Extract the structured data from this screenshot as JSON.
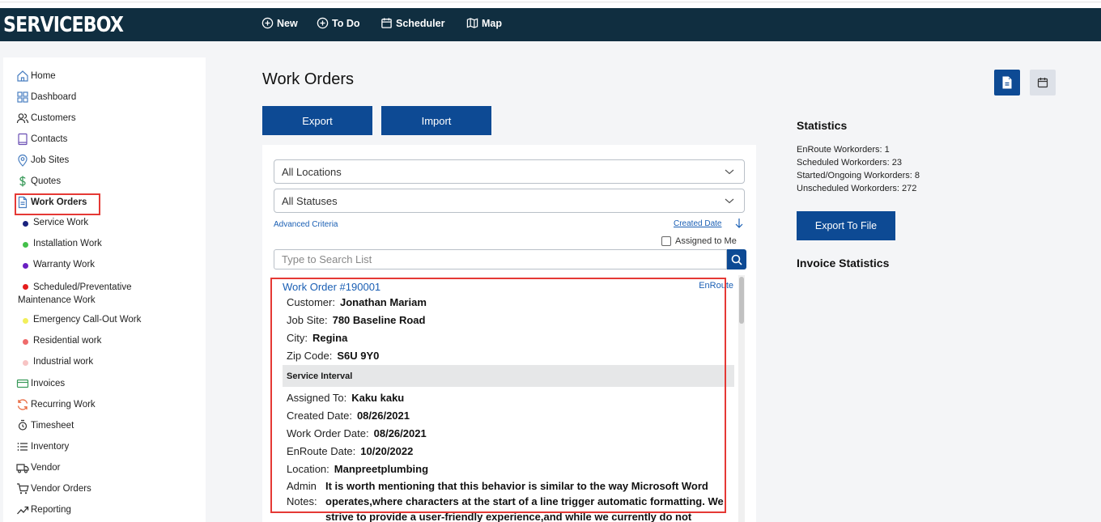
{
  "app": {
    "logo": "SERVICEBOX"
  },
  "nav": {
    "new": "New",
    "todo": "To Do",
    "scheduler": "Scheduler",
    "map": "Map"
  },
  "sidebar": {
    "home": "Home",
    "dashboard": "Dashboard",
    "customers": "Customers",
    "contacts": "Contacts",
    "job_sites": "Job Sites",
    "quotes": "Quotes",
    "work_orders": "Work Orders",
    "sub": [
      {
        "label": "Service Work",
        "color": "#1a237e"
      },
      {
        "label": "Installation Work",
        "color": "#43c04a"
      },
      {
        "label": "Warranty Work",
        "color": "#6a1fc2"
      },
      {
        "label": "Scheduled/Preventative Maintenance Work",
        "color": "#e51c1c"
      },
      {
        "label": "Emergency Call-Out Work",
        "color": "#f2ef5b"
      },
      {
        "label": "Residential work",
        "color": "#ef6b6b"
      },
      {
        "label": "Industrial work",
        "color": "#f7c4c4"
      }
    ],
    "invoices": "Invoices",
    "recurring_work": "Recurring Work",
    "timesheet": "Timesheet",
    "inventory": "Inventory",
    "vendor": "Vendor",
    "vendor_orders": "Vendor Orders",
    "reporting": "Reporting"
  },
  "main": {
    "title": "Work Orders",
    "export_label": "Export",
    "import_label": "Import",
    "locations_select": "All Locations",
    "statuses_select": "All Statuses",
    "advanced_criteria": "Advanced Criteria",
    "sort_label": "Created Date",
    "assigned_to_me": "Assigned to Me",
    "search_placeholder": "Type to Search List"
  },
  "work_order": {
    "title": "Work Order #190001",
    "status": "EnRoute",
    "customer_label": "Customer:",
    "customer": "Jonathan Mariam",
    "job_site_label": "Job Site:",
    "job_site": "780 Baseline Road",
    "city_label": "City:",
    "city": "Regina",
    "zip_label": "Zip Code:",
    "zip": "S6U 9Y0",
    "interval": "Service Interval",
    "assigned_label": "Assigned To:",
    "assigned": "Kaku kaku",
    "created_label": "Created Date:",
    "created": "08/26/2021",
    "wo_date_label": "Work Order Date:",
    "wo_date": "08/26/2021",
    "enroute_label": "EnRoute Date:",
    "enroute_date": "10/20/2022",
    "location_label": "Location:",
    "location": "Manpreetplumbing",
    "notes_label": "Admin Notes:",
    "notes": "It is worth mentioning that this behavior is similar to the way Microsoft Word operates,where characters at the start of a line trigger automatic formatting. We strive to provide a user-friendly experience,and while we currently do not"
  },
  "stats": {
    "title": "Statistics",
    "enroute": "EnRoute Workorders: 1",
    "scheduled": "Scheduled Workorders: 23",
    "started": "Started/Ongoing Workorders: 8",
    "unscheduled": "Unscheduled Workorders: 272",
    "export_file": "Export To File",
    "invoice_title": "Invoice Statistics"
  },
  "colors": {
    "header_bg": "#102e40",
    "primary": "#0d4a94",
    "link": "#1a5fb4",
    "highlight": "#e53935"
  }
}
